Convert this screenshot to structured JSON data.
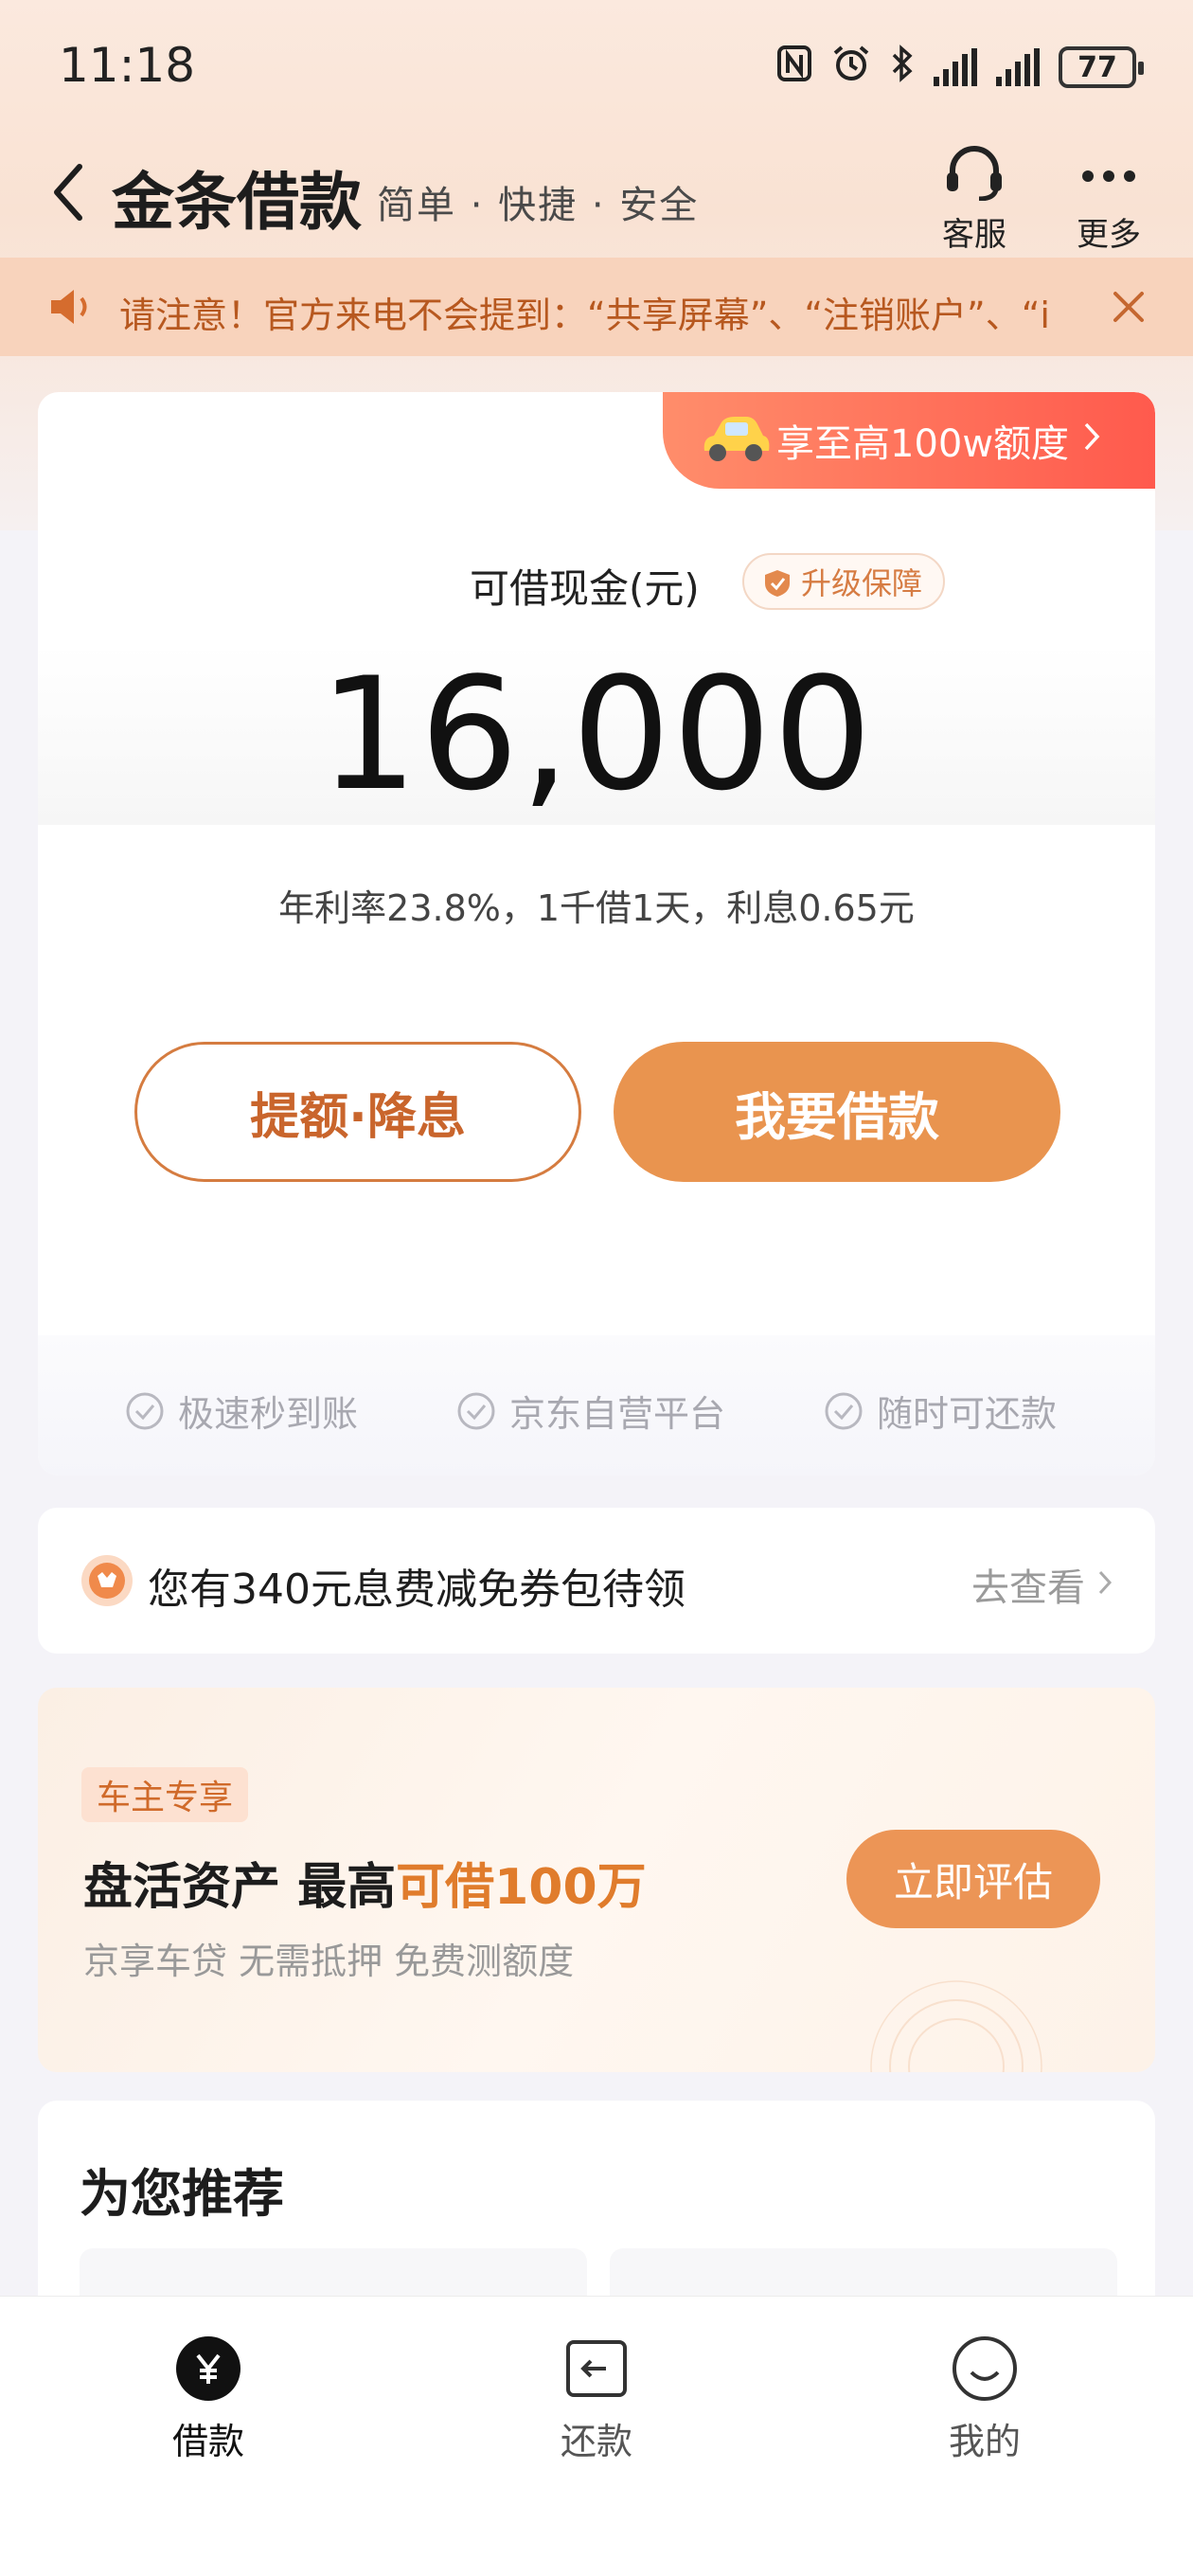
{
  "status_bar": {
    "time": "11:18",
    "battery": "77"
  },
  "header": {
    "title": "金条借款",
    "subtitle": "简单 · 快捷 · 安全",
    "customer_service": "客服",
    "more": "更多"
  },
  "notice": {
    "text": "请注意！官方来电不会提到：“共享屏幕”、“注销账户”、“i"
  },
  "loan_card": {
    "promo": "享至高100w额度",
    "cash_label": "可借现金(元)",
    "guard_badge": "升级保障",
    "amount": "16,000",
    "rate_text": "年利率23.8%，1千借1天，利息0.65元",
    "raise_button": "提额·降息",
    "borrow_button": "我要借款",
    "features": [
      "极速秒到账",
      "京东自营平台",
      "随时可还款"
    ]
  },
  "coupon": {
    "text": "您有340元息费减免券包待领",
    "link": "去查看"
  },
  "car_loan": {
    "tag": "车主专享",
    "title_prefix": "盘活资产  最高",
    "title_highlight": "可借100万",
    "desc": "京享车贷 无需抵押 免费测额度",
    "button": "立即评估"
  },
  "recommend": {
    "title": "为您推荐"
  },
  "tab_bar": {
    "tabs": [
      {
        "label": "借款",
        "icon": "yen-icon",
        "active": true
      },
      {
        "label": "还款",
        "icon": "repay-icon",
        "active": false
      },
      {
        "label": "我的",
        "icon": "smiley-icon",
        "active": false
      }
    ]
  },
  "colors": {
    "accent": "#e9944f",
    "accent_text": "#c9652c",
    "promo_red": "#ff5a4d",
    "notice_bg": "#f8d3bc"
  }
}
